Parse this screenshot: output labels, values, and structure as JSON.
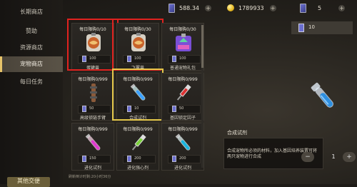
{
  "sidebar": {
    "items": [
      {
        "label": "长期商店",
        "active": false
      },
      {
        "label": "赞助",
        "active": false
      },
      {
        "label": "资源商店",
        "active": false
      },
      {
        "label": "宠物商店",
        "active": true
      },
      {
        "label": "每日任务",
        "active": false
      }
    ],
    "bottom_label": "其他交便"
  },
  "currency": {
    "gems": "588.34",
    "coins": "1789933",
    "tickets": "5"
  },
  "items": [
    {
      "limit": "每日限购0/10",
      "qty": "100",
      "name": "蛋罐兽",
      "art": "food",
      "highlight": "red"
    },
    {
      "limit": "每日限购0/30",
      "qty": "100",
      "name": "飞翼兽",
      "art": "food",
      "highlight": "red"
    },
    {
      "limit": "每日限购0/30",
      "qty": "100",
      "name": "普通宠物礼包",
      "art": "bag",
      "highlight": ""
    },
    {
      "limit": "每日限购0/999",
      "qty": "50",
      "name": "高级锁链手臂",
      "art": "arm",
      "highlight": ""
    },
    {
      "limit": "每日限购0/999",
      "qty": "10",
      "name": "合成试剂",
      "art": "vial-blue",
      "highlight": "yellow"
    },
    {
      "limit": "每日限购0/999",
      "qty": "50",
      "name": "基因锁定因子",
      "art": "syringe",
      "highlight": ""
    },
    {
      "limit": "每日限购0/999",
      "qty": "150",
      "name": "进化试剂",
      "art": "vial-pink",
      "highlight": ""
    },
    {
      "limit": "每日限购0/999",
      "qty": "200",
      "name": "进化强心剂",
      "art": "syringe-green",
      "highlight": ""
    },
    {
      "limit": "每日限购0/999",
      "qty": "200",
      "name": "进化试剂",
      "art": "vial-cyan",
      "highlight": ""
    }
  ],
  "footer": "刷新倒计时剩:20小时36分",
  "detail": {
    "tag_value": "10",
    "title": "合成试剂",
    "description": "合成宠物所必须的材料，加入基因培养装置可将两只宠物进行合成",
    "quantity": "1",
    "minus": "−",
    "plus": "+"
  }
}
